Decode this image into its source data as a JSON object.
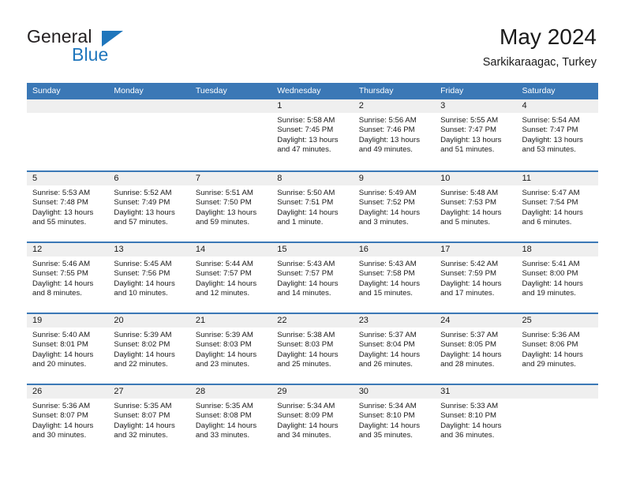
{
  "brand": {
    "name_part1": "General",
    "name_part2": "Blue",
    "triangle_color": "#1f76bc"
  },
  "header": {
    "title": "May 2024",
    "subtitle": "Sarkikaraagac, Turkey"
  },
  "colors": {
    "header_band": "#3b78b6",
    "daynum_band": "#efefef",
    "text": "#1a1a1a",
    "brand_blue": "#1f76bc"
  },
  "weekdays": [
    "Sunday",
    "Monday",
    "Tuesday",
    "Wednesday",
    "Thursday",
    "Friday",
    "Saturday"
  ],
  "weeks": [
    [
      {
        "day": "",
        "empty": true
      },
      {
        "day": "",
        "empty": true
      },
      {
        "day": "",
        "empty": true
      },
      {
        "day": "1",
        "sunrise": "Sunrise: 5:58 AM",
        "sunset": "Sunset: 7:45 PM",
        "daylight": "Daylight: 13 hours and 47 minutes."
      },
      {
        "day": "2",
        "sunrise": "Sunrise: 5:56 AM",
        "sunset": "Sunset: 7:46 PM",
        "daylight": "Daylight: 13 hours and 49 minutes."
      },
      {
        "day": "3",
        "sunrise": "Sunrise: 5:55 AM",
        "sunset": "Sunset: 7:47 PM",
        "daylight": "Daylight: 13 hours and 51 minutes."
      },
      {
        "day": "4",
        "sunrise": "Sunrise: 5:54 AM",
        "sunset": "Sunset: 7:47 PM",
        "daylight": "Daylight: 13 hours and 53 minutes."
      }
    ],
    [
      {
        "day": "5",
        "sunrise": "Sunrise: 5:53 AM",
        "sunset": "Sunset: 7:48 PM",
        "daylight": "Daylight: 13 hours and 55 minutes."
      },
      {
        "day": "6",
        "sunrise": "Sunrise: 5:52 AM",
        "sunset": "Sunset: 7:49 PM",
        "daylight": "Daylight: 13 hours and 57 minutes."
      },
      {
        "day": "7",
        "sunrise": "Sunrise: 5:51 AM",
        "sunset": "Sunset: 7:50 PM",
        "daylight": "Daylight: 13 hours and 59 minutes."
      },
      {
        "day": "8",
        "sunrise": "Sunrise: 5:50 AM",
        "sunset": "Sunset: 7:51 PM",
        "daylight": "Daylight: 14 hours and 1 minute."
      },
      {
        "day": "9",
        "sunrise": "Sunrise: 5:49 AM",
        "sunset": "Sunset: 7:52 PM",
        "daylight": "Daylight: 14 hours and 3 minutes."
      },
      {
        "day": "10",
        "sunrise": "Sunrise: 5:48 AM",
        "sunset": "Sunset: 7:53 PM",
        "daylight": "Daylight: 14 hours and 5 minutes."
      },
      {
        "day": "11",
        "sunrise": "Sunrise: 5:47 AM",
        "sunset": "Sunset: 7:54 PM",
        "daylight": "Daylight: 14 hours and 6 minutes."
      }
    ],
    [
      {
        "day": "12",
        "sunrise": "Sunrise: 5:46 AM",
        "sunset": "Sunset: 7:55 PM",
        "daylight": "Daylight: 14 hours and 8 minutes."
      },
      {
        "day": "13",
        "sunrise": "Sunrise: 5:45 AM",
        "sunset": "Sunset: 7:56 PM",
        "daylight": "Daylight: 14 hours and 10 minutes."
      },
      {
        "day": "14",
        "sunrise": "Sunrise: 5:44 AM",
        "sunset": "Sunset: 7:57 PM",
        "daylight": "Daylight: 14 hours and 12 minutes."
      },
      {
        "day": "15",
        "sunrise": "Sunrise: 5:43 AM",
        "sunset": "Sunset: 7:57 PM",
        "daylight": "Daylight: 14 hours and 14 minutes."
      },
      {
        "day": "16",
        "sunrise": "Sunrise: 5:43 AM",
        "sunset": "Sunset: 7:58 PM",
        "daylight": "Daylight: 14 hours and 15 minutes."
      },
      {
        "day": "17",
        "sunrise": "Sunrise: 5:42 AM",
        "sunset": "Sunset: 7:59 PM",
        "daylight": "Daylight: 14 hours and 17 minutes."
      },
      {
        "day": "18",
        "sunrise": "Sunrise: 5:41 AM",
        "sunset": "Sunset: 8:00 PM",
        "daylight": "Daylight: 14 hours and 19 minutes."
      }
    ],
    [
      {
        "day": "19",
        "sunrise": "Sunrise: 5:40 AM",
        "sunset": "Sunset: 8:01 PM",
        "daylight": "Daylight: 14 hours and 20 minutes."
      },
      {
        "day": "20",
        "sunrise": "Sunrise: 5:39 AM",
        "sunset": "Sunset: 8:02 PM",
        "daylight": "Daylight: 14 hours and 22 minutes."
      },
      {
        "day": "21",
        "sunrise": "Sunrise: 5:39 AM",
        "sunset": "Sunset: 8:03 PM",
        "daylight": "Daylight: 14 hours and 23 minutes."
      },
      {
        "day": "22",
        "sunrise": "Sunrise: 5:38 AM",
        "sunset": "Sunset: 8:03 PM",
        "daylight": "Daylight: 14 hours and 25 minutes."
      },
      {
        "day": "23",
        "sunrise": "Sunrise: 5:37 AM",
        "sunset": "Sunset: 8:04 PM",
        "daylight": "Daylight: 14 hours and 26 minutes."
      },
      {
        "day": "24",
        "sunrise": "Sunrise: 5:37 AM",
        "sunset": "Sunset: 8:05 PM",
        "daylight": "Daylight: 14 hours and 28 minutes."
      },
      {
        "day": "25",
        "sunrise": "Sunrise: 5:36 AM",
        "sunset": "Sunset: 8:06 PM",
        "daylight": "Daylight: 14 hours and 29 minutes."
      }
    ],
    [
      {
        "day": "26",
        "sunrise": "Sunrise: 5:36 AM",
        "sunset": "Sunset: 8:07 PM",
        "daylight": "Daylight: 14 hours and 30 minutes."
      },
      {
        "day": "27",
        "sunrise": "Sunrise: 5:35 AM",
        "sunset": "Sunset: 8:07 PM",
        "daylight": "Daylight: 14 hours and 32 minutes."
      },
      {
        "day": "28",
        "sunrise": "Sunrise: 5:35 AM",
        "sunset": "Sunset: 8:08 PM",
        "daylight": "Daylight: 14 hours and 33 minutes."
      },
      {
        "day": "29",
        "sunrise": "Sunrise: 5:34 AM",
        "sunset": "Sunset: 8:09 PM",
        "daylight": "Daylight: 14 hours and 34 minutes."
      },
      {
        "day": "30",
        "sunrise": "Sunrise: 5:34 AM",
        "sunset": "Sunset: 8:10 PM",
        "daylight": "Daylight: 14 hours and 35 minutes."
      },
      {
        "day": "31",
        "sunrise": "Sunrise: 5:33 AM",
        "sunset": "Sunset: 8:10 PM",
        "daylight": "Daylight: 14 hours and 36 minutes."
      },
      {
        "day": "",
        "empty": true
      }
    ]
  ]
}
